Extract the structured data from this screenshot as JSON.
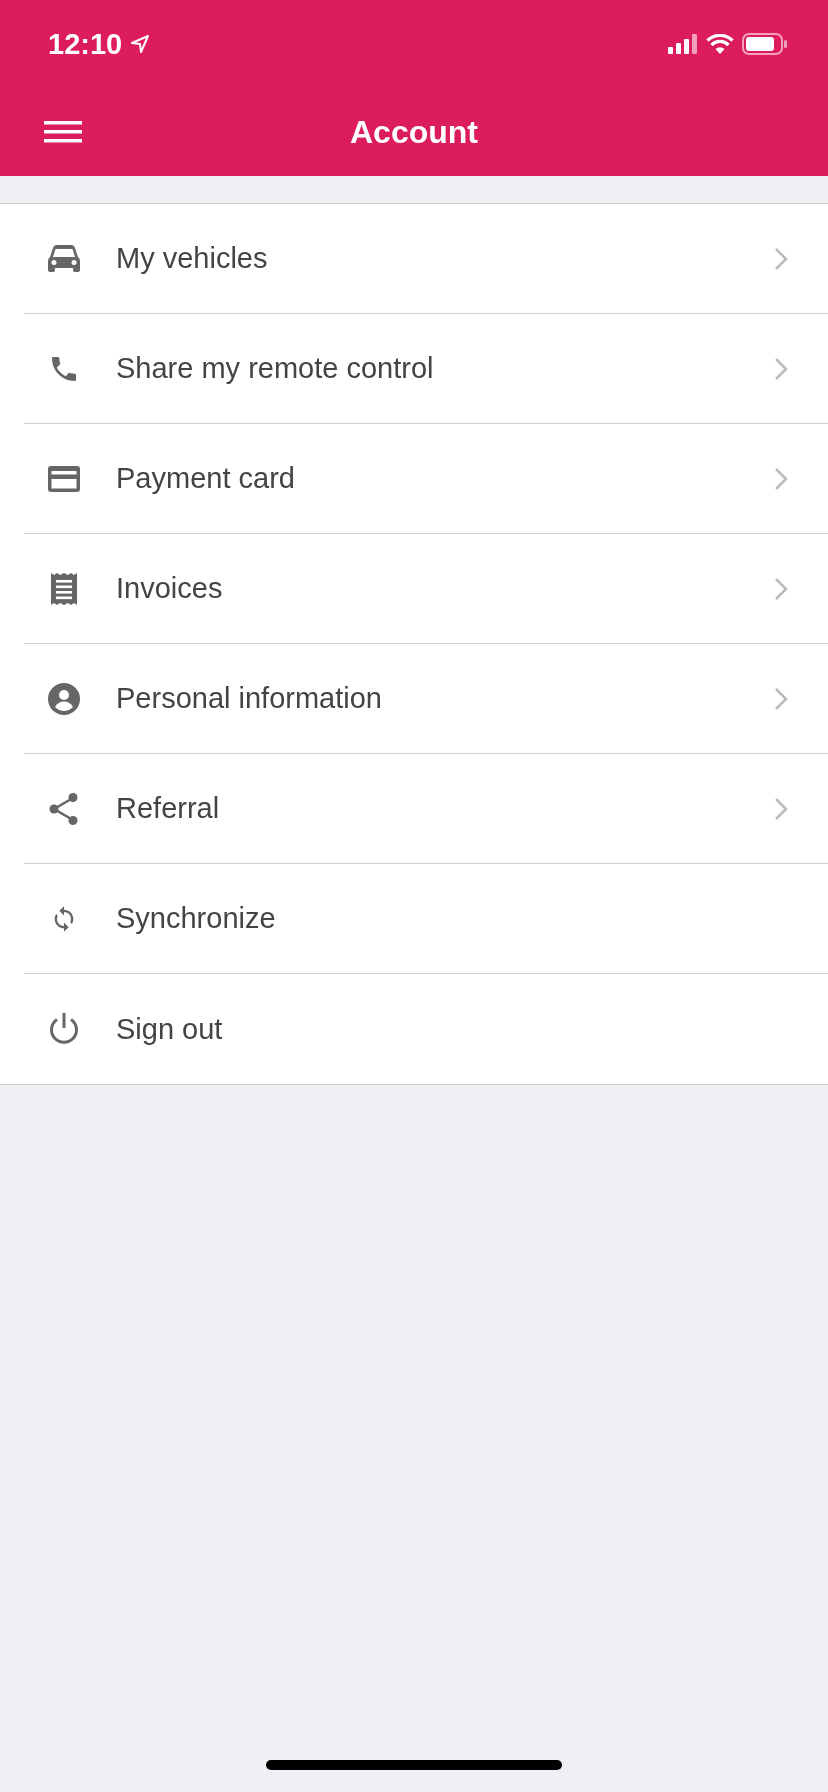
{
  "status_bar": {
    "time": "12:10"
  },
  "header": {
    "title": "Account"
  },
  "menu_items": [
    {
      "label": "My vehicles",
      "has_chevron": true
    },
    {
      "label": "Share my remote control",
      "has_chevron": true
    },
    {
      "label": "Payment card",
      "has_chevron": true
    },
    {
      "label": "Invoices",
      "has_chevron": true
    },
    {
      "label": "Personal information",
      "has_chevron": true
    },
    {
      "label": "Referral",
      "has_chevron": true
    },
    {
      "label": "Synchronize",
      "has_chevron": false
    },
    {
      "label": "Sign out",
      "has_chevron": false
    }
  ]
}
